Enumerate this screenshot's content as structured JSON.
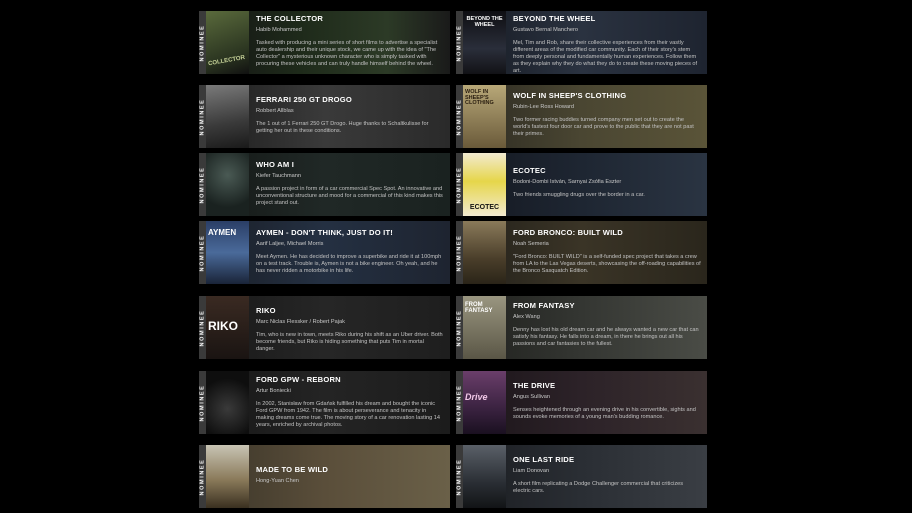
{
  "nominee_label": "NOMINEE",
  "films": [
    {
      "title": "THE COLLECTOR",
      "credit": "Habib Mohammed",
      "description": "Tasked with producing a mini series of short films to advertise a specialist auto dealership and their unique stock, we came up with the idea of \"The Collector\" a mysterious unknown character who is simply tasked with procuring these vehicles and can truly handle himself behind the wheel.",
      "poster_text": "COLLECTOR",
      "theme_color": "#2c3a26",
      "poster_color": "#3c4a2e"
    },
    {
      "title": "BEYOND THE WHEEL",
      "credit": "Gustavo Bernal Manchero",
      "description": "Mel, Tim and Rob, share their collective experiences from their vastly different areas of the modified car community. Each of their story's stem from deeply personal and fundamentally human experiences. Follow them as they explain why they do what they do to create these moving pieces of art.",
      "poster_text": "BEYOND THE WHEEL",
      "theme_color": "#2a3240",
      "poster_color": "#1c1f2a"
    },
    {
      "title": "FERRARI 250 GT DROGO",
      "credit": "Robbert Allblas",
      "description": "The 1 out of 1 Ferrari 250 GT Drogo. Huge thanks to Schaltkulisse for getting her out in these conditions.",
      "poster_text": "",
      "theme_color": "#3a3a3a",
      "poster_color": "#5a5a5a"
    },
    {
      "title": "WOLF IN SHEEP'S CLOTHING",
      "credit": "Rubin-Lee Ross Howard",
      "description": "Two former racing buddies turned company men set out to create the world's fastest four door car and prove to the public that they are not past their primes.",
      "poster_text": "WOLF IN SHEEP'S CLOTHING",
      "theme_color": "#4a4632",
      "poster_color": "#8a7a52"
    },
    {
      "title": "WHO AM I",
      "credit": "Kiefer Tauchmann",
      "description": "A passion project in form of a car commercial Spec Spot. An innovative and unconventional structure and mood for a commercial of this kind makes this project stand out.",
      "poster_text": "",
      "theme_color": "#202826",
      "poster_color": "#2a3432"
    },
    {
      "title": "ECOTEC",
      "credit": "Bodoni-Dombi István, Sarnyai Zsófia Eszter",
      "description": "Two friends smuggling drugs over the border in a car.",
      "poster_text": "ECOTEC",
      "theme_color": "#1e2632",
      "poster_color": "#e6d64a"
    },
    {
      "title": "AYMEN - DON'T THINK, JUST DO IT!",
      "credit": "Aarif Laljee, Michael Morris",
      "description": "Meet Aymen. He has decided to improve a superbike and ride it at 100mph on a test track. Trouble is, Aymen is not a bike engineer. Oh yeah, and he has never ridden a motorbike in his life.",
      "poster_text": "AYMEN",
      "theme_color": "#243042",
      "poster_color": "#2a3e66"
    },
    {
      "title": "FORD BRONCO: BUILT WILD",
      "credit": "Noah Semeria",
      "description": "\"Ford Bronco: BUILT WILD\" is a self-funded spec project that takes a crew from LA to the Las Vegas deserts, showcasing the off-roading capabilities of the Bronco Sasquatch Edition.",
      "poster_text": "",
      "theme_color": "#3a3426",
      "poster_color": "#6a5a3c"
    },
    {
      "title": "RIKO",
      "credit": "Marc Niclas Flessker / Robert Pajak",
      "description": "Tim, who is new in town, meets Riko during his shift as an Uber driver. Both become friends, but Riko is hiding something that puts Tim in mortal danger.",
      "poster_text": "RIKO",
      "theme_color": "#262626",
      "poster_color": "#3a2a22"
    },
    {
      "title": "FROM FANTASY",
      "credit": "Alex Wang",
      "description": "Denny has lost his old dream car and he always wanted a new car that can satisfy his fantasy. He falls into a dream, in there he brings out all his passions and car fantasies to the fullest.",
      "poster_text": "FROM FANTASY",
      "theme_color": "#343632",
      "poster_color": "#7a7660"
    },
    {
      "title": "FORD GPW - REBORN",
      "credit": "Artur Boniecki",
      "description": "In 2002, Stanisław from Gdańsk fulfilled his dream and bought the iconic Ford GPW from 1942. The film is about perseverance and tenacity in making dreams come true. The moving story of a car renovation lasting 14 years, enriched by archival photos.",
      "poster_text": "",
      "theme_color": "#242424",
      "poster_color": "#1a1a1a"
    },
    {
      "title": "THE DRIVE",
      "credit": "Angus Sullivan",
      "description": "Senses heightened through an evening drive in his convertible, sights and sounds evoke memories of a young man's budding romance.",
      "poster_text": "Drive",
      "theme_color": "#2c2228",
      "poster_color": "#4a2e4a"
    },
    {
      "title": "MADE TO BE WILD",
      "credit": "Hong-Yuan Chen",
      "description": "",
      "poster_text": "",
      "theme_color": "#5a4e3a",
      "poster_color": "#8a7a5a"
    },
    {
      "title": "ONE LAST RIDE",
      "credit": "Liam Donovan",
      "description": "A short film replicating a Dodge Challenger commercial that criticizes electric cars.",
      "poster_text": "",
      "theme_color": "#2a2e34",
      "poster_color": "#3a4048"
    }
  ]
}
